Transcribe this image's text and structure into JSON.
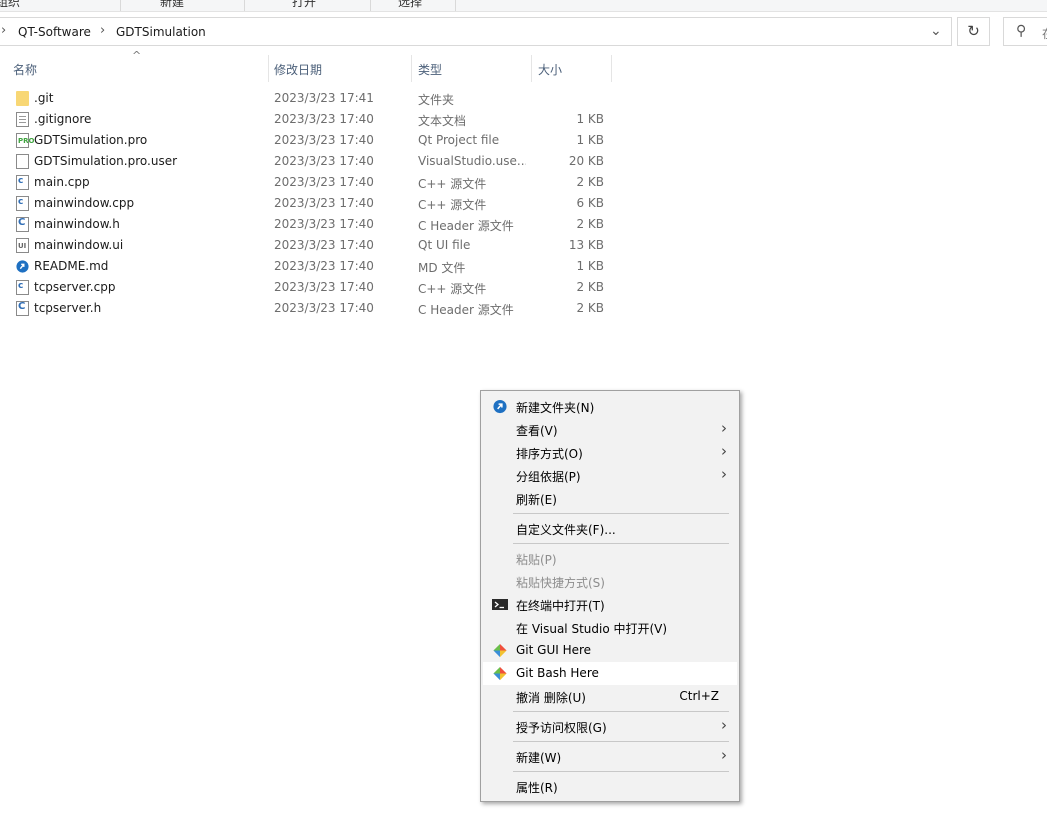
{
  "ribbon": {
    "items": [
      "组织",
      "新建",
      "打开",
      "选择"
    ]
  },
  "address": {
    "crumbs": [
      "QT-Software",
      "GDTSimulation"
    ],
    "search_placeholder": "在"
  },
  "columns": {
    "name": "名称",
    "date": "修改日期",
    "type": "类型",
    "size": "大小"
  },
  "files": [
    {
      "name": ".git",
      "date": "2023/3/23 17:41",
      "type": "文件夹",
      "size": "",
      "icon": "folder-icon"
    },
    {
      "name": ".gitignore",
      "date": "2023/3/23 17:40",
      "type": "文本文档",
      "size": "1 KB",
      "icon": "text-file-icon"
    },
    {
      "name": "GDTSimulation.pro",
      "date": "2023/3/23 17:40",
      "type": "Qt Project file",
      "size": "1 KB",
      "icon": "qt-project-file-icon"
    },
    {
      "name": "GDTSimulation.pro.user",
      "date": "2023/3/23 17:40",
      "type": "VisualStudio.use...",
      "size": "20 KB",
      "icon": "blank-file-icon"
    },
    {
      "name": "main.cpp",
      "date": "2023/3/23 17:40",
      "type": "C++ 源文件",
      "size": "2 KB",
      "icon": "cpp-file-icon"
    },
    {
      "name": "mainwindow.cpp",
      "date": "2023/3/23 17:40",
      "type": "C++ 源文件",
      "size": "6 KB",
      "icon": "cpp-file-icon"
    },
    {
      "name": "mainwindow.h",
      "date": "2023/3/23 17:40",
      "type": "C Header 源文件",
      "size": "2 KB",
      "icon": "header-file-icon"
    },
    {
      "name": "mainwindow.ui",
      "date": "2023/3/23 17:40",
      "type": "Qt UI file",
      "size": "13 KB",
      "icon": "ui-file-icon"
    },
    {
      "name": "README.md",
      "date": "2023/3/23 17:40",
      "type": "MD 文件",
      "size": "1 KB",
      "icon": "markdown-file-icon"
    },
    {
      "name": "tcpserver.cpp",
      "date": "2023/3/23 17:40",
      "type": "C++ 源文件",
      "size": "2 KB",
      "icon": "cpp-file-icon"
    },
    {
      "name": "tcpserver.h",
      "date": "2023/3/23 17:40",
      "type": "C Header 源文件",
      "size": "2 KB",
      "icon": "header-file-icon"
    }
  ],
  "context_menu": {
    "new_folder": "新建文件夹(N)",
    "view": "查看(V)",
    "sort_by": "排序方式(O)",
    "group_by": "分组依据(P)",
    "refresh": "刷新(E)",
    "customize_folder": "自定义文件夹(F)...",
    "paste": "粘贴(P)",
    "paste_shortcut": "粘贴快捷方式(S)",
    "open_in_terminal": "在终端中打开(T)",
    "open_in_visual_studio": "在 Visual Studio 中打开(V)",
    "git_gui_here": "Git GUI Here",
    "git_bash_here": "Git Bash Here",
    "undo_delete": "撤消 删除(U)",
    "undo_shortcut": "Ctrl+Z",
    "give_access_to": "授予访问权限(G)",
    "new": "新建(W)",
    "properties": "属性(R)"
  },
  "colors": {
    "header_text": "#4c607a",
    "menu_bg": "#f2f2f2",
    "menu_hover": "#ffffff",
    "disabled_text": "#8d8d8d",
    "folder": "#f8d775"
  }
}
